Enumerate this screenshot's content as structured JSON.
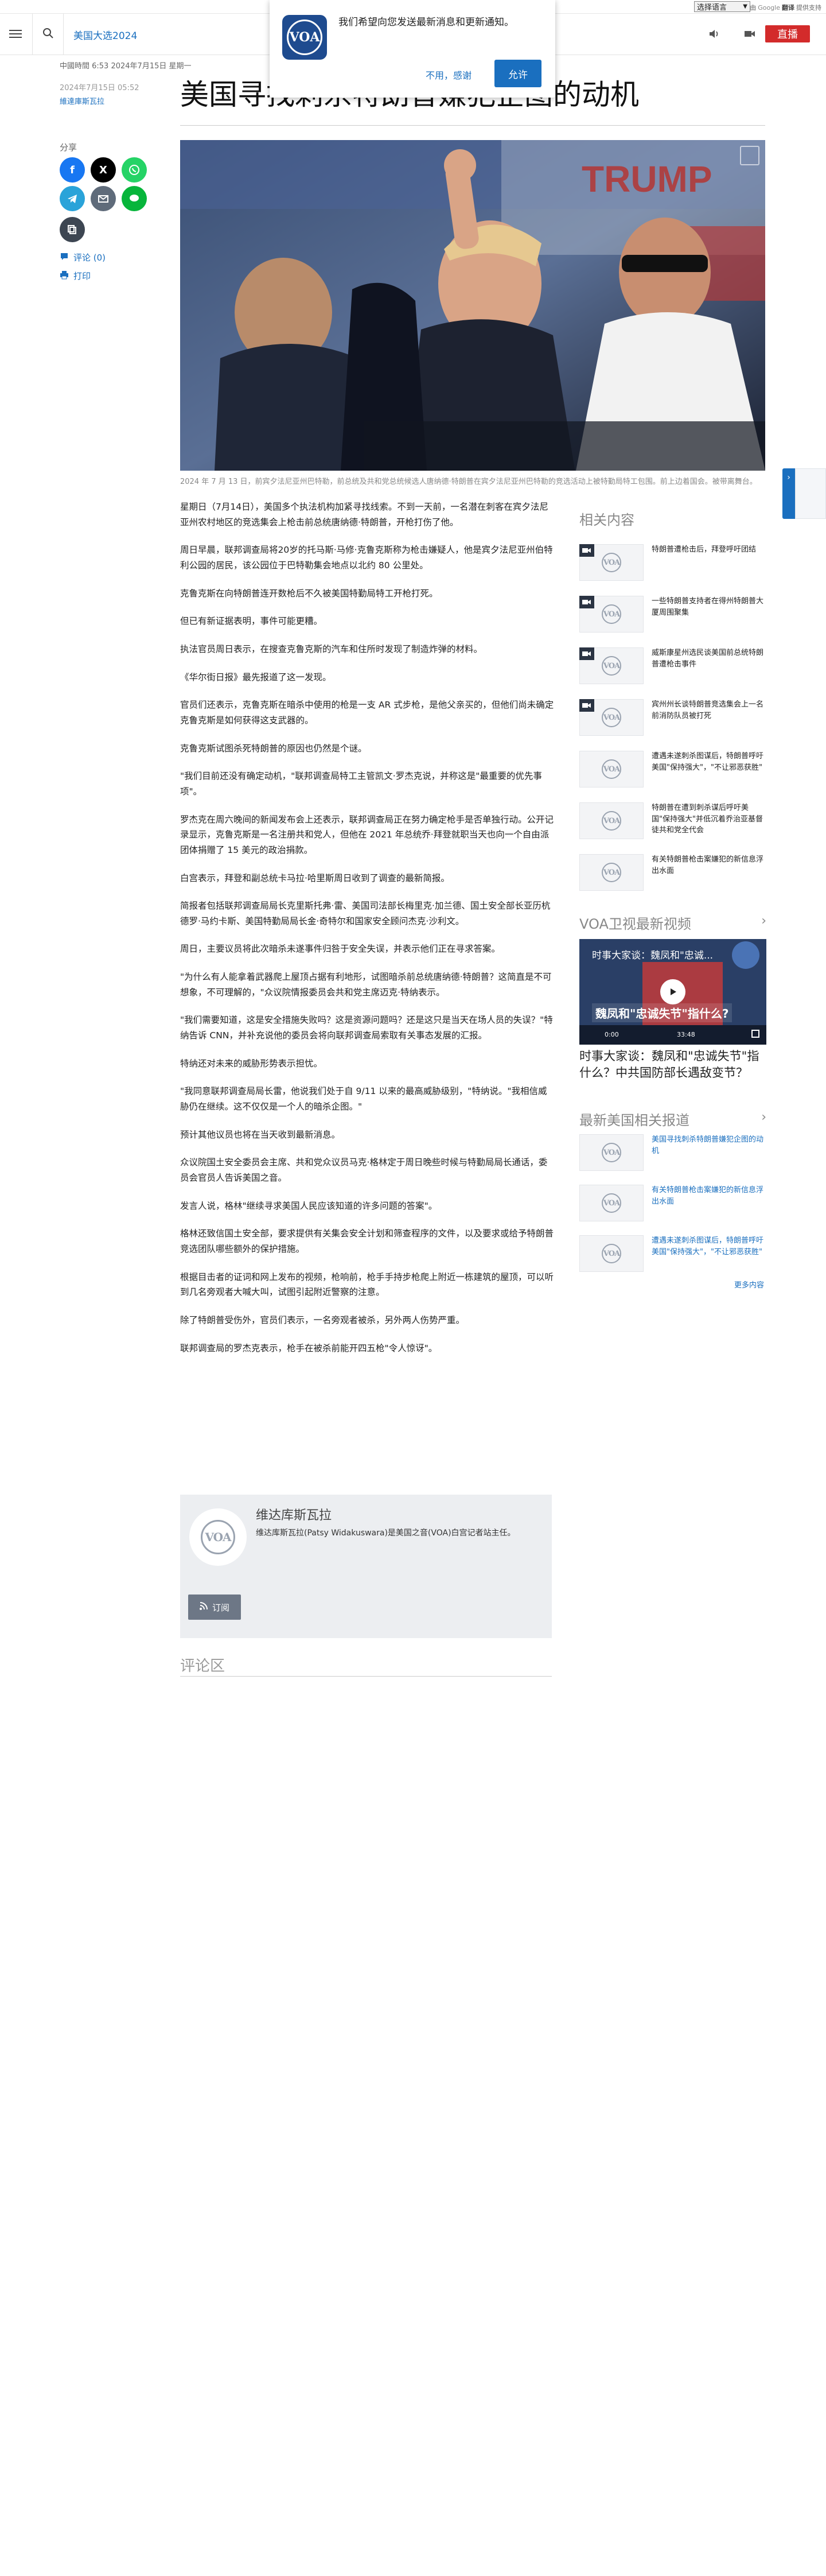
{
  "translate": {
    "select_label": "选择语言",
    "powered_prefix": "由",
    "powered_brand": "Google",
    "powered_product": "翻译",
    "powered_suffix": "提供支持"
  },
  "header": {
    "section": "美国大选2024",
    "live_label": "直播"
  },
  "push_popup": {
    "message": "我们希望向您发送最新消息和更新通知。",
    "decline": "不用，感谢",
    "accept": "允许",
    "logo_text": "VOA"
  },
  "article": {
    "small_meta": "中國時間 6:53 2024年7月15日 星期一",
    "date": "2024年7月15日 05:52",
    "author_link": "維達庫斯瓦拉",
    "title": "美国寻找刺杀特朗普嫌犯企图的动机",
    "caption": "2024 年 7 月 13 日，前宾夕法尼亚州巴特勒，前总统及共和党总统候选人唐纳德·特朗普在宾夕法尼亚州巴特勒的竞选活动上被特勤局特工包围。前上边着国会。被带离舞台。",
    "paragraphs": [
      "星期日（7月14日），美国多个执法机构加紧寻找线索。不到一天前，一名潜在刺客在宾夕法尼亚州农村地区的竞选集会上枪击前总统唐纳德·特朗普，开枪打伤了他。",
      "周日早晨，联邦调查局将20岁的托马斯·马修·克鲁克斯称为枪击嫌疑人，他是宾夕法尼亚州伯特利公园的居民，该公园位于巴特勒集会地点以北约 80 公里处。",
      "克鲁克斯在向特朗普连开数枪后不久被美国特勤局特工开枪打死。",
      "但已有新证据表明，事件可能更糟。",
      "执法官员周日表示，在搜查克鲁克斯的汽车和住所时发现了制造炸弹的材料。",
      "《华尔街日报》最先报道了这一发现。",
      "官员们还表示，克鲁克斯在暗杀中使用的枪是一支 AR 式步枪，是他父亲买的，但他们尚未确定克鲁克斯是如何获得这支武器的。",
      "克鲁克斯试图杀死特朗普的原因也仍然是个谜。",
      "\"我们目前还没有确定动机，\"联邦调查局特工主管凯文·罗杰克说，并称这是\"最重要的优先事项\"。",
      "罗杰克在周六晚间的新闻发布会上还表示，联邦调查局正在努力确定枪手是否单独行动。公开记录显示，克鲁克斯是一名注册共和党人，但他在 2021 年总统乔·拜登就职当天也向一个自由派团体捐赠了 15 美元的政治捐款。",
      "白宫表示，拜登和副总统卡马拉·哈里斯周日收到了调查的最新简报。",
      "简报者包括联邦调查局局长克里斯托弗·雷、美国司法部长梅里克·加兰德、国土安全部长亚历杭德罗·马约卡斯、美国特勤局局长金·奇特尔和国家安全顾问杰克·沙利文。",
      "周日，主要议员将此次暗杀未遂事件归咎于安全失误，并表示他们正在寻求答案。",
      "\"为什么有人能拿着武器爬上屋顶占据有利地形，试图暗杀前总统唐纳德·特朗普？这简直是不可想象，不可理解的，\"众议院情报委员会共和党主席迈克·特纳表示。",
      "\"我们需要知道，这是安全措施失败吗？这是资源问题吗？还是这只是当天在场人员的失误？\"特纳告诉 CNN，并补充说他的委员会将向联邦调查局索取有关事态发展的汇报。",
      "特纳还对未来的威胁形势表示担忧。",
      "\"我同意联邦调查局局长雷，他说我们处于自 9/11 以来的最高威胁级别，\"特纳说。\"我相信威胁仍在继续。这不仅仅是一个人的暗杀企图。\"",
      "预计其他议员也将在当天收到最新消息。",
      "众议院国土安全委员会主席、共和党众议员马克·格林定于周日晚些时候与特勤局局长通话，委员会官员人告诉美国之音。",
      "发言人说，格林\"继续寻求美国人民应该知道的许多问题的答案\"。",
      "格林还致信国土安全部，要求提供有关集会安全计划和筛查程序的文件，以及要求或给予特朗普竞选团队哪些额外的保护措施。",
      "根据目击者的证词和网上发布的视频，枪响前，枪手手持步枪爬上附近一栋建筑的屋顶，可以听到几名旁观者大喊大叫，试图引起附近警察的注意。",
      "除了特朗普受伤外，官员们表示，一名旁观者被杀，另外两人伤势严重。",
      "联邦调查局的罗杰克表示，枪手在被杀前能开四五枪\"令人惊讶\"。"
    ]
  },
  "share": {
    "label": "分享",
    "comments": "评论 (0)",
    "print": "打印"
  },
  "author_card": {
    "name": "维达库斯瓦拉",
    "bio": "维达库斯瓦拉(Patsy Widakuswara)是美国之音(VOA)白宫记者站主任。",
    "subscribe": "订阅"
  },
  "comments": {
    "title": "评论区"
  },
  "sidebar": {
    "related_title": "相关内容",
    "related": [
      {
        "text": "特朗普遭枪击后，拜登呼吁团结",
        "video": true
      },
      {
        "text": "一些特朗普支持者在得州特朗普大厦周围聚集",
        "video": true
      },
      {
        "text": "威斯康星州选民谈美国前总统特朗普遭枪击事件",
        "video": true
      },
      {
        "text": "宾州州长谈特朗普竞选集会上一名前消防队员被打死",
        "video": true
      },
      {
        "text": "遭遇未遂刺杀图谋后，特朗普呼吁美国\"保持强大\"，\"不让邪恶获胜\"",
        "video": false
      },
      {
        "text": "特朗普在遭到刺杀谋后呼吁美国\"保持强大\"并低沉着乔治亚基督徒共和党全代会",
        "video": false
      },
      {
        "text": "有关特朗普枪击案嫌犯的新信息浮出水面",
        "video": false
      }
    ],
    "video_title": "VOA卫视最新视频",
    "video_overlay_top": "时事大家谈：魏凤和\"忠诚...",
    "video_overlay_main": "魏凤和\"忠诚失节\"指什么?",
    "video_time": "0:00",
    "video_duration": "33:48",
    "video_caption": "时事大家谈：魏凤和\"忠诚失节\"指什么？中共国防部长遇敌变节？",
    "latest_title": "最新美国相关报道",
    "latest": [
      {
        "text": "美国寻找刺杀特朗普嫌犯企图的动机"
      },
      {
        "text": "有关特朗普枪击案嫌犯的新信息浮出水面"
      },
      {
        "text": "遭遇未遂刺杀图谋后，特朗普呼吁美国\"保持强大\"，\"不让邪恶获胜\""
      }
    ],
    "more": "更多内容"
  },
  "colors": {
    "accent": "#1a6fbf",
    "live": "#d32b2b",
    "facebook": "#1877f2",
    "x": "#000000",
    "whatsapp": "#25d366",
    "telegram": "#2aa3d9",
    "email": "#5f6b7a",
    "line": "#07b53b",
    "copy": "#3d4652"
  }
}
